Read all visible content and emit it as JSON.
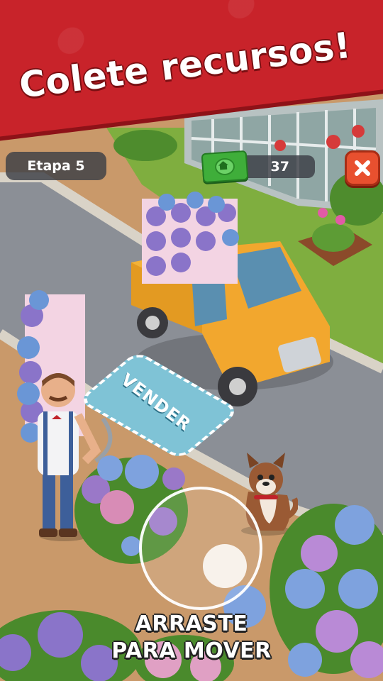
{
  "banner": {
    "title": "Colete recursos!"
  },
  "hud": {
    "stage_label": "Etapa 5",
    "coins": "37",
    "coin_icon": "cash-bill-icon",
    "close_icon": "close-icon"
  },
  "sell_zone": {
    "label": "VENDER"
  },
  "instruction": {
    "line1": "ARRASTE",
    "line2": "PARA MOVER"
  },
  "colors": {
    "banner_red": "#c8232a",
    "close_orange": "#e8502f",
    "truck_yellow": "#f2a72e",
    "sell_pad_blue": "#7fc3d6"
  }
}
